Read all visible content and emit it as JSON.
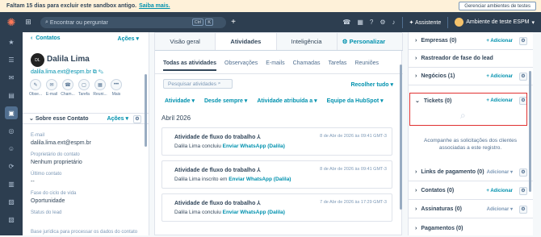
{
  "banner": {
    "text": "Faltam 15 dias para excluir este sandbox antigo.",
    "link": "Saiba mais.",
    "button": "Gerenciar ambientes de testes"
  },
  "topbar": {
    "search_placeholder": "Encontrar ou perguntar",
    "kbd1": "Ctrl",
    "kbd2": "K",
    "assist": "Assistente",
    "env": "Ambiente de teste ESPM"
  },
  "contact": {
    "back": "Contatos",
    "actions": "Ações",
    "avatar": "DL",
    "name": "Dalila Lima",
    "email": "dalila.lima.ext@espm.br"
  },
  "quick_actions": [
    "Obse...",
    "E-mail",
    "Cham...",
    "Tarefa",
    "Reuni...",
    "Mais"
  ],
  "about": {
    "title": "Sobre esse Contato",
    "actions": "Ações"
  },
  "fields": [
    {
      "label": "E-mail",
      "value": "dalila.lima.ext@espm.br"
    },
    {
      "label": "Proprietário do contato",
      "value": "Nenhum proprietário"
    },
    {
      "label": "Último contato",
      "value": "--"
    },
    {
      "label": "Fase do ciclo de vida",
      "value": "Oportunidade"
    },
    {
      "label": "Status do lead",
      "value": ""
    },
    {
      "label": "Base jurídica para processar os dados do contato",
      "value": ""
    }
  ],
  "tabs": [
    "Visão geral",
    "Atividades",
    "Inteligência",
    "Personalizar"
  ],
  "subtabs": [
    "Todas as atividades",
    "Observações",
    "E-mails",
    "Chamadas",
    "Tarefas",
    "Reuniões"
  ],
  "activity_search": "Pesquisar atividades",
  "collapse": "Recolher tudo",
  "filters": [
    "Atividade",
    "Desde sempre",
    "Atividade atribuída a",
    "Equipe da HubSpot"
  ],
  "month": "Abril 2026",
  "activities": [
    {
      "title": "Atividade de fluxo do trabalho",
      "date": "8 de Abr de 2026 às 09:41 GMT-3",
      "pre": "Dalila Lima concluiu ",
      "link": "Enviar WhatsApp (Dalila)"
    },
    {
      "title": "Atividade de fluxo do trabalho",
      "date": "8 de Abr de 2026 às 09:41 GMT-3",
      "pre": "Dalila Lima inscrito em ",
      "link": "Enviar WhatsApp (Dalila)"
    },
    {
      "title": "Atividade de fluxo do trabalho",
      "date": "7 de Abr de 2026 às 17:29 GMT-3",
      "pre": "Dalila Lima concluiu ",
      "link": "Enviar WhatsApp (Dalila)"
    }
  ],
  "sidebar": [
    {
      "label": "Empresas (0)",
      "add": "+ Adicionar"
    },
    {
      "label": "Rastreador de fase do lead",
      "add": ""
    },
    {
      "label": "Negócios (1)",
      "add": "+ Adicionar"
    },
    {
      "label": "Tickets (0)",
      "add": "+ Adicionar"
    },
    {
      "label": "Links de pagamento (0)",
      "add": "Adicionar"
    },
    {
      "label": "Contatos (0)",
      "add": "+ Adicionar"
    },
    {
      "label": "Assinaturas (0)",
      "add": "Adicionar"
    },
    {
      "label": "Pagamentos (0)",
      "add": ""
    }
  ],
  "tickets_msg": "Acompanhe as solicitações dos clientes associadas a este registro."
}
